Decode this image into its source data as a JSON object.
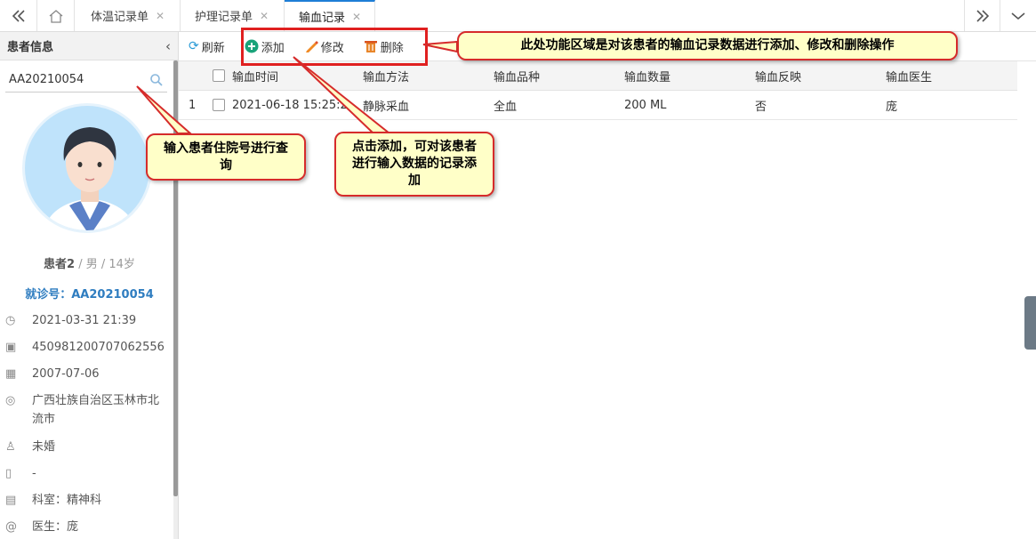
{
  "tabs": [
    {
      "label": "体温记录单"
    },
    {
      "label": "护理记录单"
    },
    {
      "label": "输血记录"
    }
  ],
  "sidebar": {
    "title": "患者信息",
    "search_value": "AA20210054",
    "patient_name": "患者2",
    "patient_meta": " / 男 / 14岁",
    "visit_id": "就诊号：AA20210054",
    "info": [
      {
        "icon": "clock-icon",
        "text": "2021-03-31 21:39"
      },
      {
        "icon": "id-card-icon",
        "text": "450981200707062556"
      },
      {
        "icon": "calendar-icon",
        "text": "2007-07-06"
      },
      {
        "icon": "location-icon",
        "text": "广西壮族自治区玉林市北流市"
      },
      {
        "icon": "user-icon",
        "text": "未婚"
      },
      {
        "icon": "phone-icon",
        "text": "-"
      },
      {
        "icon": "department-icon",
        "text": "科室：精神科"
      },
      {
        "icon": "at-icon",
        "text": "医生：庞"
      }
    ]
  },
  "toolbar": {
    "refresh": "刷新",
    "add": "添加",
    "edit": "修改",
    "delete": "删除"
  },
  "table": {
    "headers": [
      "输血时间",
      "输血方法",
      "输血品种",
      "输血数量",
      "输血反映",
      "输血医生"
    ],
    "rows": [
      {
        "num": "1",
        "cells": [
          "2021-06-18 15:25:2",
          "静脉采血",
          "全血",
          "200 ML",
          "否",
          "庞"
        ]
      }
    ]
  },
  "callouts": {
    "toolbar_note": "此处功能区域是对该患者的输血记录数据进行添加、修改和删除操作",
    "search_note": "输入患者住院号进行查询",
    "add_note": "点击添加，可对该患者进行输入数据的记录添加"
  },
  "colors": {
    "accent": "#1e7ed6",
    "callout_bg": "#ffffc8",
    "callout_border": "#d62b2b"
  }
}
